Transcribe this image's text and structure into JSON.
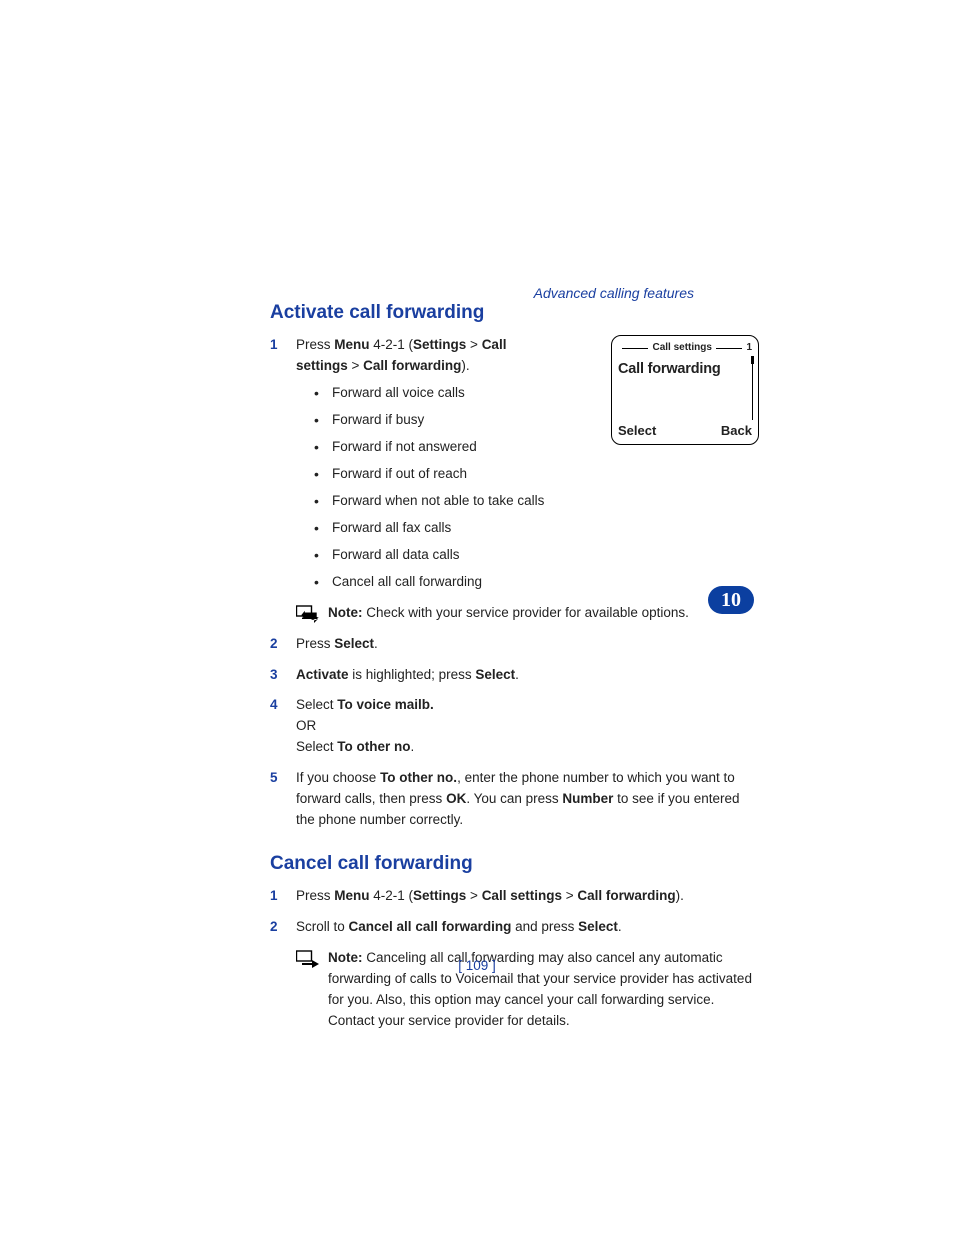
{
  "header": {
    "label": "Advanced calling features"
  },
  "chapter": "10",
  "page_number": "[ 109 ]",
  "phone": {
    "top_label": "Call settings",
    "top_index": "1",
    "main": "Call forwarding",
    "soft_left": "Select",
    "soft_right": "Back"
  },
  "section_a": {
    "title": "Activate call forwarding",
    "step1": {
      "num": "1",
      "p1_a": "Press ",
      "p1_b": "Menu",
      "p1_c": " 4-2-1 (",
      "p1_d": "Settings",
      "p1_e": " > ",
      "p1_f": "Call settings",
      "p1_g": " > ",
      "p1_h": "Call forwarding",
      "p1_i": ").",
      "bullets": [
        "Forward all voice calls",
        "Forward if busy",
        "Forward if not answered",
        "Forward if out of reach",
        "Forward when not able to take calls",
        "Forward all fax calls",
        "Forward all data calls",
        "Cancel all call forwarding"
      ]
    },
    "note1": {
      "label": "Note:",
      "text": " Check with your service provider for available options."
    },
    "step2": {
      "num": "2",
      "a": "Press ",
      "b": "Select",
      "c": "."
    },
    "step3": {
      "num": "3",
      "a": "Activate",
      "b": " is highlighted; press ",
      "c": "Select",
      "d": "."
    },
    "step4": {
      "num": "4",
      "a": "Select ",
      "b": "To voice mailb.",
      "or": "OR",
      "c": "Select ",
      "d": "To other no",
      "e": "."
    },
    "step5": {
      "num": "5",
      "a": "If you choose ",
      "b": "To other no.",
      "c": ", enter the phone number to which you want to forward calls, then press ",
      "d": "OK",
      "e": ". You can press ",
      "f": "Number",
      "g": " to see if you entered the phone number correctly."
    }
  },
  "section_b": {
    "title": "Cancel call forwarding",
    "step1": {
      "num": "1",
      "a": "Press ",
      "b": "Menu",
      "c": " 4-2-1 (",
      "d": "Settings",
      "e": " > ",
      "f": "Call settings",
      "g": " > ",
      "h": "Call forwarding",
      "i": ")."
    },
    "step2": {
      "num": "2",
      "a": "Scroll to ",
      "b": "Cancel all call forwarding",
      "c": " and press ",
      "d": "Select",
      "e": "."
    },
    "note": {
      "label": "Note:",
      "text": " Canceling all call forwarding may also cancel any automatic forwarding of calls to Voicemail that your service provider has activated for you. Also, this option may cancel your call forwarding service. Contact your service provider for details."
    }
  }
}
